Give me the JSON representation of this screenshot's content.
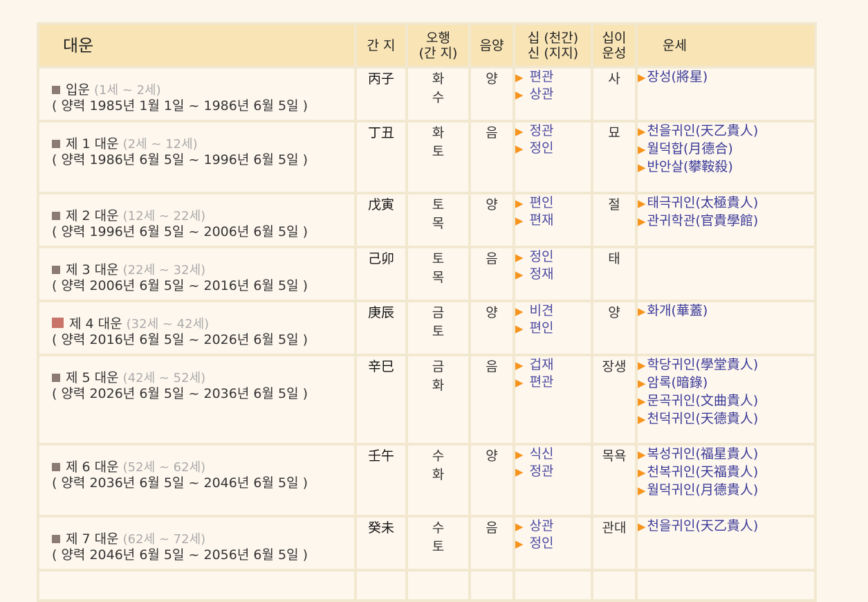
{
  "headers": {
    "daeun": "대운",
    "ganji": "간 지",
    "ohaeng": "오행\n(간 지)",
    "eumyang": "음양",
    "sipsin": "십 (천간)\n신 (지지)",
    "sibiunseong": "십이\n운성",
    "unse": "운세"
  },
  "rows": [
    {
      "name": "입운",
      "age": "(1세 ~ 2세)",
      "period": "( 양력 1985년 1월 1일 ~ 1986년 6월 5일 )",
      "ganji": "丙子",
      "oh1": "화",
      "oh2": "수",
      "eumyang": "양",
      "ss1": "편관",
      "ss2": "상관",
      "sib": "사",
      "unse": [
        "장성(將星)"
      ],
      "current": false
    },
    {
      "name": "제 1 대운",
      "age": "(2세 ~ 12세)",
      "period": "( 양력 1986년 6월 5일 ~ 1996년 6월 5일 )",
      "ganji": "丁丑",
      "oh1": "화",
      "oh2": "토",
      "eumyang": "음",
      "ss1": "정관",
      "ss2": "정인",
      "sib": "묘",
      "unse": [
        "천을귀인(天乙貴人)",
        "월덕합(月德合)",
        "반안살(攀鞍殺)"
      ],
      "current": false
    },
    {
      "name": "제 2 대운",
      "age": "(12세 ~ 22세)",
      "period": "( 양력 1996년 6월 5일 ~ 2006년 6월 5일 )",
      "ganji": "戊寅",
      "oh1": "토",
      "oh2": "목",
      "eumyang": "양",
      "ss1": "편인",
      "ss2": "편재",
      "sib": "절",
      "unse": [
        "태극귀인(太極貴人)",
        "관귀학관(官貴學館)"
      ],
      "current": false
    },
    {
      "name": "제 3 대운",
      "age": "(22세 ~ 32세)",
      "period": "( 양력 2006년 6월 5일 ~ 2016년 6월 5일 )",
      "ganji": "己卯",
      "oh1": "토",
      "oh2": "목",
      "eumyang": "음",
      "ss1": "정인",
      "ss2": "정재",
      "sib": "태",
      "unse": [],
      "current": false
    },
    {
      "name": "제 4 대운",
      "age": "(32세 ~ 42세)",
      "period": "( 양력 2016년 6월 5일 ~ 2026년 6월 5일 )",
      "ganji": "庚辰",
      "oh1": "금",
      "oh2": "토",
      "eumyang": "양",
      "ss1": "비견",
      "ss2": "편인",
      "sib": "양",
      "unse": [
        "화개(華蓋)"
      ],
      "current": true
    },
    {
      "name": "제 5 대운",
      "age": "(42세 ~ 52세)",
      "period": "( 양력 2026년 6월 5일 ~ 2036년 6월 5일 )",
      "ganji": "辛巳",
      "oh1": "금",
      "oh2": "화",
      "eumyang": "음",
      "ss1": "겁재",
      "ss2": "편관",
      "sib": "장생",
      "unse": [
        "학당귀인(學堂貴人)",
        "암록(暗錄)",
        "문곡귀인(文曲貴人)",
        "천덕귀인(天德貴人)"
      ],
      "current": false
    },
    {
      "name": "제 6 대운",
      "age": "(52세 ~ 62세)",
      "period": "( 양력 2036년 6월 5일 ~ 2046년 6월 5일 )",
      "ganji": "壬午",
      "oh1": "수",
      "oh2": "화",
      "eumyang": "양",
      "ss1": "식신",
      "ss2": "정관",
      "sib": "목욕",
      "unse": [
        "복성귀인(福星貴人)",
        "천복귀인(天福貴人)",
        "월덕귀인(月德貴人)"
      ],
      "current": false
    },
    {
      "name": "제 7 대운",
      "age": "(62세 ~ 72세)",
      "period": "( 양력 2046년 6월 5일 ~ 2056년 6월 5일 )",
      "ganji": "癸未",
      "oh1": "수",
      "oh2": "토",
      "eumyang": "음",
      "ss1": "상관",
      "ss2": "정인",
      "sib": "관대",
      "unse": [
        "천을귀인(天乙貴人)"
      ],
      "current": false
    }
  ],
  "colors": {
    "header_bg": "#f8e4b5",
    "cell_bg": "#fef7ee",
    "border": "#f2e8cf",
    "link": "#3a3a98",
    "triangle": "#f7941d",
    "current_marker": "#c97469"
  },
  "icons": {
    "bullet": "square-bullet-icon",
    "arrow": "triangle-right-icon"
  }
}
